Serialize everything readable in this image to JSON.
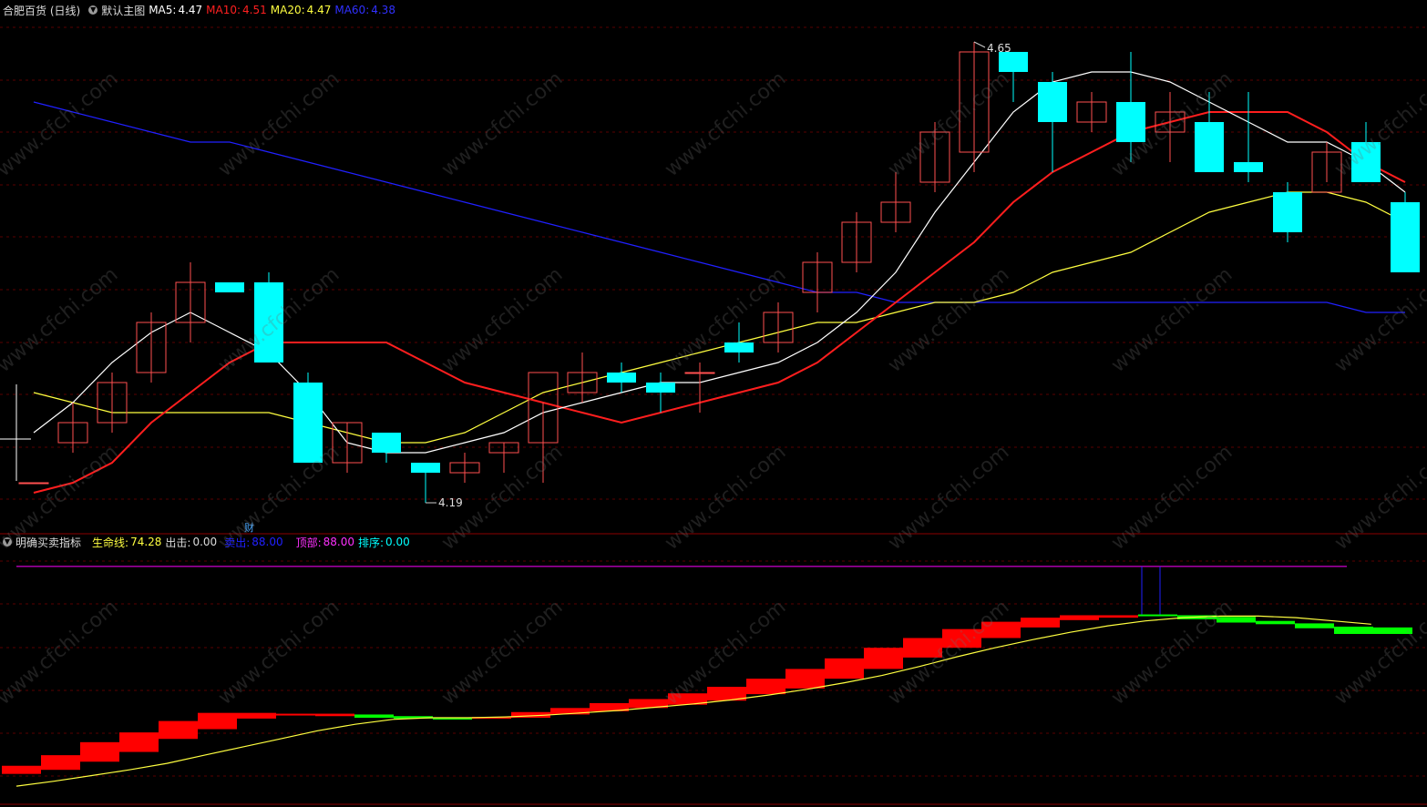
{
  "main_header": {
    "stock_name": "合肥百货 (日线)",
    "chart_mode": "默认主图",
    "ma5_label": "MA5:",
    "ma5_value": "4.47",
    "ma10_label": "MA10:",
    "ma10_value": "4.51",
    "ma20_label": "MA20:",
    "ma20_value": "4.47",
    "ma60_label": "MA60:",
    "ma60_value": "4.38"
  },
  "sub_header": {
    "indicator_name": "明确买卖指标",
    "life_line_label": "生命线:",
    "life_line_value": "74.28",
    "exit_label": "出击:",
    "exit_value": "0.00",
    "sell_label": "卖出:",
    "sell_value": "88.00",
    "top_label": "顶部:",
    "top_value": "88.00",
    "rank_label": "排序:",
    "rank_value": "0.00"
  },
  "annotations": {
    "high_label": "4.65",
    "low_label": "4.19",
    "finance_marker": "财"
  },
  "watermark": "www.cfchi.com",
  "colors": {
    "up": "#ff5050",
    "down": "#00ffff",
    "ma5": "#ffffff",
    "ma10": "#ff1e1e",
    "ma20": "#ffff40",
    "ma60": "#2020ff",
    "bar_up": "#ff0000",
    "bar_down": "#00ff00",
    "life_line": "#ffff40",
    "grid": "#5a0000",
    "top_line": "#ff00ff"
  },
  "chart_data": [
    {
      "type": "candlestick",
      "title": "合肥百货 (日线)",
      "ylim": [
        4.17,
        4.67
      ],
      "candles": [
        {
          "o": 4.21,
          "h": 4.21,
          "l": 4.21,
          "c": 4.21
        },
        {
          "o": 4.25,
          "h": 4.29,
          "l": 4.24,
          "c": 4.27
        },
        {
          "o": 4.27,
          "h": 4.32,
          "l": 4.26,
          "c": 4.31
        },
        {
          "o": 4.32,
          "h": 4.38,
          "l": 4.31,
          "c": 4.37
        },
        {
          "o": 4.37,
          "h": 4.43,
          "l": 4.35,
          "c": 4.41
        },
        {
          "o": 4.41,
          "h": 4.41,
          "l": 4.41,
          "c": 4.4
        },
        {
          "o": 4.41,
          "h": 4.42,
          "l": 4.34,
          "c": 4.33
        },
        {
          "o": 4.31,
          "h": 4.32,
          "l": 4.23,
          "c": 4.23
        },
        {
          "o": 4.23,
          "h": 4.27,
          "l": 4.22,
          "c": 4.27
        },
        {
          "o": 4.26,
          "h": 4.26,
          "l": 4.23,
          "c": 4.24
        },
        {
          "o": 4.23,
          "h": 4.23,
          "l": 4.19,
          "c": 4.22
        },
        {
          "o": 4.22,
          "h": 4.24,
          "l": 4.21,
          "c": 4.23
        },
        {
          "o": 4.24,
          "h": 4.25,
          "l": 4.22,
          "c": 4.25
        },
        {
          "o": 4.25,
          "h": 4.29,
          "l": 4.21,
          "c": 4.32
        },
        {
          "o": 4.3,
          "h": 4.34,
          "l": 4.29,
          "c": 4.32
        },
        {
          "o": 4.32,
          "h": 4.33,
          "l": 4.3,
          "c": 4.31
        },
        {
          "o": 4.31,
          "h": 4.32,
          "l": 4.28,
          "c": 4.3
        },
        {
          "o": 4.32,
          "h": 4.33,
          "l": 4.28,
          "c": 4.32
        },
        {
          "o": 4.35,
          "h": 4.37,
          "l": 4.33,
          "c": 4.34
        },
        {
          "o": 4.35,
          "h": 4.39,
          "l": 4.34,
          "c": 4.38
        },
        {
          "o": 4.4,
          "h": 4.44,
          "l": 4.38,
          "c": 4.43
        },
        {
          "o": 4.43,
          "h": 4.48,
          "l": 4.42,
          "c": 4.47
        },
        {
          "o": 4.47,
          "h": 4.52,
          "l": 4.46,
          "c": 4.49
        },
        {
          "o": 4.51,
          "h": 4.57,
          "l": 4.5,
          "c": 4.56
        },
        {
          "o": 4.54,
          "h": 4.65,
          "l": 4.52,
          "c": 4.64
        },
        {
          "o": 4.64,
          "h": 4.64,
          "l": 4.59,
          "c": 4.62
        },
        {
          "o": 4.61,
          "h": 4.62,
          "l": 4.52,
          "c": 4.57
        },
        {
          "o": 4.57,
          "h": 4.6,
          "l": 4.56,
          "c": 4.59
        },
        {
          "o": 4.59,
          "h": 4.64,
          "l": 4.53,
          "c": 4.55
        },
        {
          "o": 4.56,
          "h": 4.6,
          "l": 4.53,
          "c": 4.58
        },
        {
          "o": 4.57,
          "h": 4.6,
          "l": 4.53,
          "c": 4.52
        },
        {
          "o": 4.53,
          "h": 4.6,
          "l": 4.51,
          "c": 4.52
        },
        {
          "o": 4.5,
          "h": 4.51,
          "l": 4.45,
          "c": 4.46
        },
        {
          "o": 4.5,
          "h": 4.55,
          "l": 4.51,
          "c": 4.54
        },
        {
          "o": 4.55,
          "h": 4.57,
          "l": 4.51,
          "c": 4.51
        },
        {
          "o": 4.49,
          "h": 4.5,
          "l": 4.42,
          "c": 4.42
        }
      ],
      "ma5": [
        4.26,
        4.29,
        4.33,
        4.36,
        4.38,
        4.36,
        4.34,
        4.3,
        4.25,
        4.24,
        4.24,
        4.25,
        4.26,
        4.28,
        4.29,
        4.3,
        4.31,
        4.31,
        4.32,
        4.33,
        4.35,
        4.38,
        4.42,
        4.48,
        4.53,
        4.58,
        4.61,
        4.62,
        4.62,
        4.61,
        4.59,
        4.57,
        4.55,
        4.55,
        4.53,
        4.5
      ],
      "ma10": [
        4.2,
        4.21,
        4.23,
        4.27,
        4.3,
        4.33,
        4.35,
        4.35,
        4.35,
        4.35,
        4.33,
        4.31,
        4.3,
        4.29,
        4.28,
        4.27,
        4.28,
        4.29,
        4.3,
        4.31,
        4.33,
        4.36,
        4.39,
        4.42,
        4.45,
        4.49,
        4.52,
        4.54,
        4.56,
        4.57,
        4.58,
        4.58,
        4.58,
        4.56,
        4.53,
        4.51
      ],
      "ma20": [
        4.3,
        4.29,
        4.28,
        4.28,
        4.28,
        4.28,
        4.28,
        4.27,
        4.26,
        4.25,
        4.25,
        4.26,
        4.28,
        4.3,
        4.31,
        4.32,
        4.33,
        4.34,
        4.35,
        4.36,
        4.37,
        4.37,
        4.38,
        4.39,
        4.39,
        4.4,
        4.42,
        4.43,
        4.44,
        4.46,
        4.48,
        4.49,
        4.5,
        4.5,
        4.49,
        4.47
      ],
      "ma60": [
        4.59,
        4.58,
        4.57,
        4.56,
        4.55,
        4.55,
        4.54,
        4.53,
        4.52,
        4.51,
        4.5,
        4.49,
        4.48,
        4.47,
        4.46,
        4.45,
        4.44,
        4.43,
        4.42,
        4.41,
        4.4,
        4.4,
        4.39,
        4.39,
        4.39,
        4.39,
        4.39,
        4.39,
        4.39,
        4.39,
        4.39,
        4.39,
        4.39,
        4.39,
        4.38,
        4.38
      ]
    },
    {
      "type": "bar",
      "title": "明确买卖指标",
      "ylim": [
        60,
        90
      ],
      "top_line": 88.0,
      "bars": [
        {
          "lo": 62.5,
          "hi": 63.5,
          "dir": "up"
        },
        {
          "lo": 63.0,
          "hi": 64.8,
          "dir": "up"
        },
        {
          "lo": 64.0,
          "hi": 66.4,
          "dir": "up"
        },
        {
          "lo": 65.2,
          "hi": 67.6,
          "dir": "up"
        },
        {
          "lo": 66.8,
          "hi": 69.0,
          "dir": "up"
        },
        {
          "lo": 68.0,
          "hi": 70.0,
          "dir": "up"
        },
        {
          "lo": 69.3,
          "hi": 70.0,
          "dir": "up"
        },
        {
          "lo": 69.7,
          "hi": 69.9,
          "dir": "up"
        },
        {
          "lo": 69.6,
          "hi": 69.9,
          "dir": "up"
        },
        {
          "lo": 69.4,
          "hi": 69.8,
          "dir": "down"
        },
        {
          "lo": 69.3,
          "hi": 69.6,
          "dir": "down"
        },
        {
          "lo": 69.3,
          "hi": 69.4,
          "dir": "down"
        },
        {
          "lo": 69.3,
          "hi": 69.5,
          "dir": "up"
        },
        {
          "lo": 69.4,
          "hi": 70.1,
          "dir": "up"
        },
        {
          "lo": 69.8,
          "hi": 70.6,
          "dir": "up"
        },
        {
          "lo": 70.2,
          "hi": 71.2,
          "dir": "up"
        },
        {
          "lo": 70.6,
          "hi": 71.7,
          "dir": "up"
        },
        {
          "lo": 71.0,
          "hi": 72.4,
          "dir": "up"
        },
        {
          "lo": 71.5,
          "hi": 73.2,
          "dir": "up"
        },
        {
          "lo": 72.3,
          "hi": 74.2,
          "dir": "up"
        },
        {
          "lo": 73.0,
          "hi": 75.4,
          "dir": "up"
        },
        {
          "lo": 74.2,
          "hi": 76.7,
          "dir": "up"
        },
        {
          "lo": 75.4,
          "hi": 78.0,
          "dir": "up"
        },
        {
          "lo": 76.8,
          "hi": 79.2,
          "dir": "up"
        },
        {
          "lo": 78.0,
          "hi": 80.3,
          "dir": "up"
        },
        {
          "lo": 79.2,
          "hi": 81.2,
          "dir": "up"
        },
        {
          "lo": 80.5,
          "hi": 81.7,
          "dir": "up"
        },
        {
          "lo": 81.4,
          "hi": 82.0,
          "dir": "up"
        },
        {
          "lo": 81.7,
          "hi": 82.0,
          "dir": "up"
        },
        {
          "lo": 81.9,
          "hi": 82.1,
          "dir": "down"
        },
        {
          "lo": 81.5,
          "hi": 82.0,
          "dir": "down"
        },
        {
          "lo": 81.1,
          "hi": 81.8,
          "dir": "down"
        },
        {
          "lo": 80.9,
          "hi": 81.3,
          "dir": "down"
        },
        {
          "lo": 80.4,
          "hi": 81.0,
          "dir": "down"
        },
        {
          "lo": 79.7,
          "hi": 80.6,
          "dir": "down"
        },
        {
          "lo": 79.7,
          "hi": 80.5,
          "dir": "down"
        }
      ],
      "life_line": [
        61.0,
        61.6,
        62.3,
        63.0,
        63.8,
        64.8,
        65.8,
        66.8,
        67.8,
        68.6,
        69.2,
        69.4,
        69.4,
        69.5,
        69.7,
        70.0,
        70.3,
        70.7,
        71.1,
        71.6,
        72.2,
        72.9,
        73.7,
        74.6,
        75.7,
        76.9,
        78.0,
        79.0,
        79.9,
        80.7,
        81.3,
        81.7,
        81.9,
        81.9,
        81.7,
        81.3,
        80.9
      ]
    }
  ]
}
